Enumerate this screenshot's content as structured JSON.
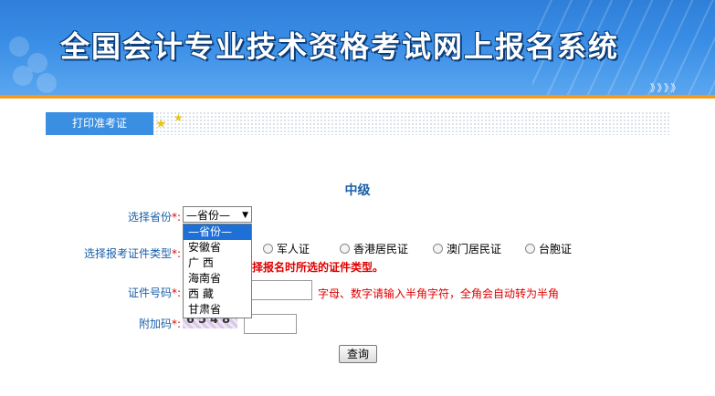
{
  "header": {
    "title": "全国会计专业技术资格考试网上报名系统",
    "arrows": "》》》》"
  },
  "tabs": {
    "print_ticket": "打印准考证"
  },
  "form": {
    "level": "中级",
    "province": {
      "label": "选择省份",
      "required_mark": "*:",
      "selected": "—省份—",
      "options": [
        "—省份—",
        "安徽省",
        "广 西",
        "海南省",
        "西 藏",
        "甘肃省"
      ]
    },
    "id_type": {
      "label": "选择报考证件类型",
      "required_mark": "*:",
      "options": [
        "军人证",
        "香港居民证",
        "澳门居民证",
        "台胞证"
      ],
      "warning": "择报名时所选的证件类型。"
    },
    "id_number": {
      "label": "证件号码",
      "required_mark": "*:",
      "value": "",
      "hint": "字母、数字请输入半角字符，全角会自动转为半角"
    },
    "captcha": {
      "label": "附加码",
      "required_mark": "*:",
      "image_text": "6548",
      "value": ""
    },
    "submit_label": "查询"
  },
  "colors": {
    "banner": "#3a8ee6",
    "accent_bar": "#f39a1a",
    "label_blue": "#1a5fa8",
    "required_red": "#e00000"
  }
}
